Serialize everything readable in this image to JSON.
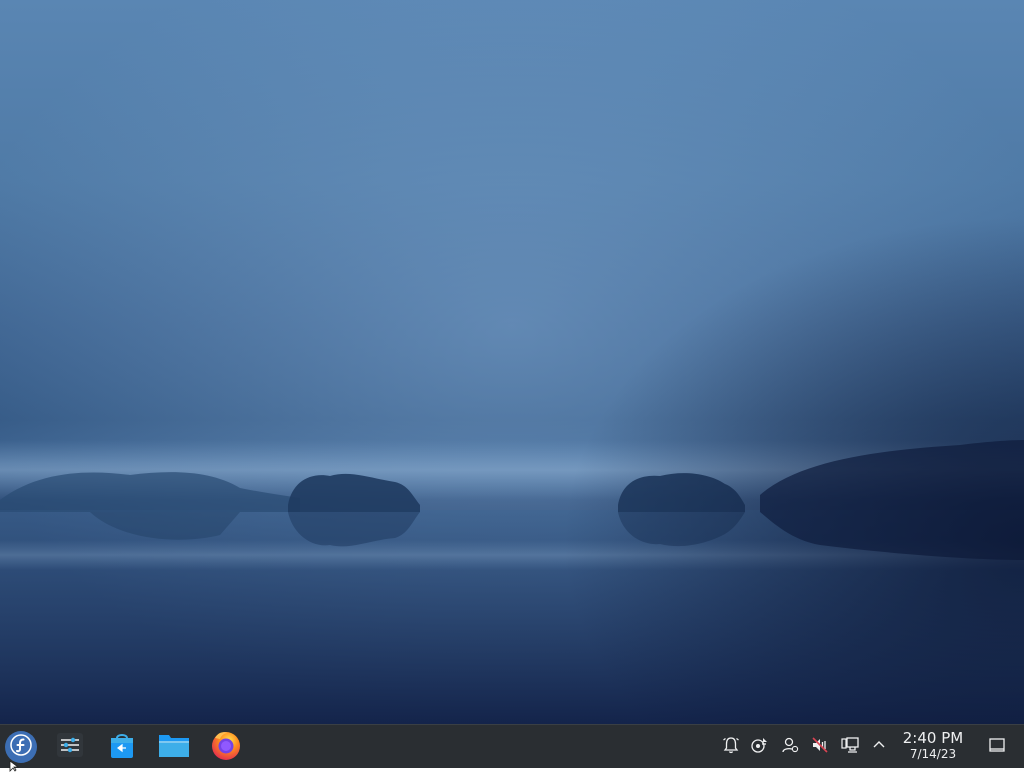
{
  "taskbar": {
    "launcher": {
      "icon": "fedora-logo-icon"
    },
    "tasks": [
      {
        "icon": "system-settings-icon"
      },
      {
        "icon": "discover-store-icon"
      },
      {
        "icon": "file-manager-icon"
      },
      {
        "icon": "firefox-icon"
      }
    ],
    "tray": [
      {
        "icon": "notifications-icon"
      },
      {
        "icon": "kde-connect-icon"
      },
      {
        "icon": "user-switcher-icon"
      },
      {
        "icon": "volume-muted-icon"
      },
      {
        "icon": "network-wired-icon"
      },
      {
        "icon": "expand-tray-arrow-icon"
      }
    ],
    "clock": {
      "time": "2:40 PM",
      "date": "7/14/23"
    },
    "show_desktop": {
      "icon": "show-desktop-icon"
    }
  },
  "colors": {
    "panel_bg": "#2a2e32",
    "accent": "#3daee9",
    "fedora_blue": "#3c6eb4"
  }
}
